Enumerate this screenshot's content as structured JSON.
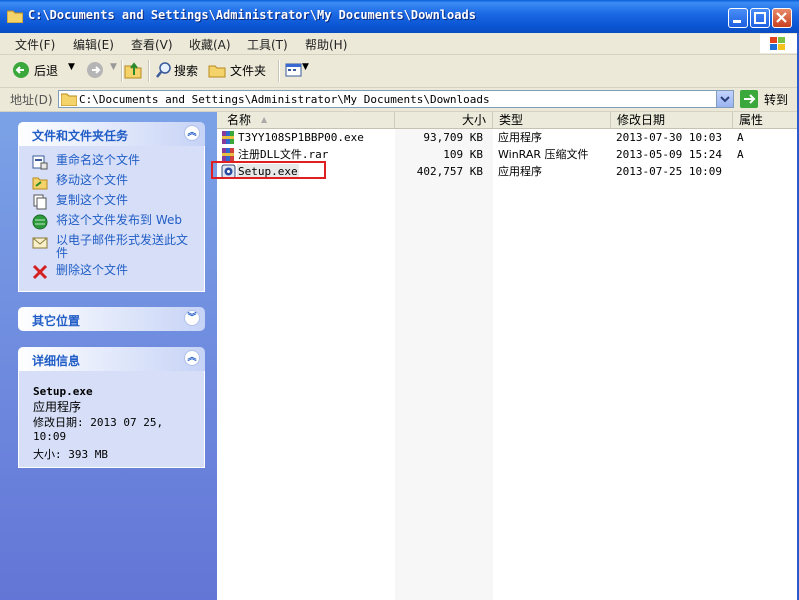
{
  "window": {
    "title": "C:\\Documents and Settings\\Administrator\\My Documents\\Downloads"
  },
  "menubar": {
    "items": [
      "文件(F)",
      "编辑(E)",
      "查看(V)",
      "收藏(A)",
      "工具(T)",
      "帮助(H)"
    ]
  },
  "toolbar": {
    "back": "后退",
    "search": "搜索",
    "folders": "文件夹"
  },
  "address": {
    "label": "地址(D)",
    "value": "C:\\Documents and Settings\\Administrator\\My Documents\\Downloads",
    "go": "转到"
  },
  "tasks_panel": {
    "title": "文件和文件夹任务",
    "items": [
      {
        "label": "重命名这个文件",
        "icon": "rename-icon"
      },
      {
        "label": "移动这个文件",
        "icon": "move-icon"
      },
      {
        "label": "复制这个文件",
        "icon": "copy-icon"
      },
      {
        "label": "将这个文件发布到 Web",
        "icon": "publish-web-icon"
      },
      {
        "label": "以电子邮件形式发送此文件",
        "icon": "email-icon"
      },
      {
        "label": "删除这个文件",
        "icon": "delete-icon"
      }
    ]
  },
  "other_places": {
    "title": "其它位置"
  },
  "details": {
    "title": "详细信息",
    "name": "Setup.exe",
    "type": "应用程序",
    "modified": "修改日期: 2013 07 25, 10:09",
    "size": "大小: 393 MB"
  },
  "columns": {
    "name": "名称",
    "size": "大小",
    "type": "类型",
    "modified": "修改日期",
    "attr": "属性"
  },
  "files": [
    {
      "name": "T3YY108SP1BBP00.exe",
      "size": "93,709 KB",
      "type": "应用程序",
      "modified": "2013-07-30 10:03",
      "attr": "A",
      "icon": "exe-archive-icon"
    },
    {
      "name": "注册DLL文件.rar",
      "size": "109 KB",
      "type": "WinRAR 压缩文件",
      "modified": "2013-05-09 15:24",
      "attr": "A",
      "icon": "rar-archive-icon"
    },
    {
      "name": "Setup.exe",
      "size": "402,757 KB",
      "type": "应用程序",
      "modified": "2013-07-25 10:09",
      "attr": "",
      "icon": "setup-icon",
      "selected": true
    }
  ],
  "colors": {
    "titlebar": "#0a55d2",
    "taskpane": "#7ba2e7",
    "link": "#215dc6",
    "selection_border": "#e02020"
  }
}
